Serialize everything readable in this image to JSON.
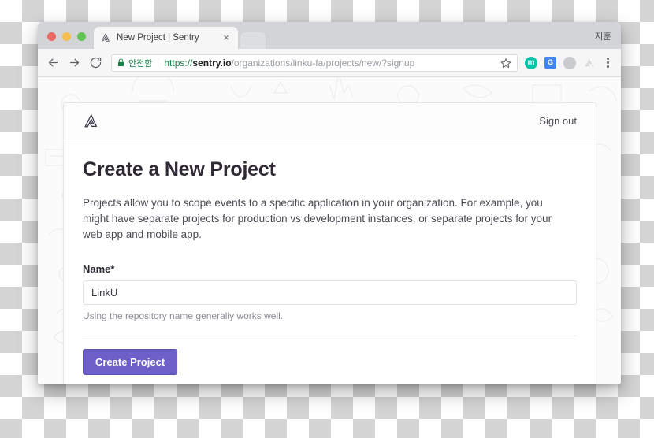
{
  "browser": {
    "profile_name": "지훈",
    "tab": {
      "title": "New Project | Sentry",
      "favicon_name": "sentry-favicon",
      "close_label": "×"
    },
    "toolbar": {
      "back_icon": "back-arrow-icon",
      "forward_icon": "forward-arrow-icon",
      "reload_icon": "reload-icon",
      "secure_label": "안전함",
      "url_scheme": "https://",
      "url_host": "sentry.io",
      "url_path": "/organizations/linku-fa/projects/new/?signup",
      "bookmark_icon": "star-icon",
      "extension_m_label": "m",
      "extension_translate_label": "G",
      "menu_icon": "three-dot-menu-icon"
    }
  },
  "page": {
    "header": {
      "logo_name": "sentry-logo",
      "sign_out_label": "Sign out"
    },
    "title": "Create a New Project",
    "description": "Projects allow you to scope events to a specific application in your organization. For example, you might have separate projects for production vs development instances, or separate projects for your web app and mobile app.",
    "form": {
      "name_label": "Name*",
      "name_value": "LinkU",
      "name_placeholder": "",
      "name_help": "Using the repository name generally works well.",
      "submit_label": "Create Project"
    }
  },
  "colors": {
    "brand_purple": "#6C5FC7",
    "secure_green": "#0F8244",
    "title_dark": "#2F2936",
    "page_bg": "#FBFBFC"
  }
}
